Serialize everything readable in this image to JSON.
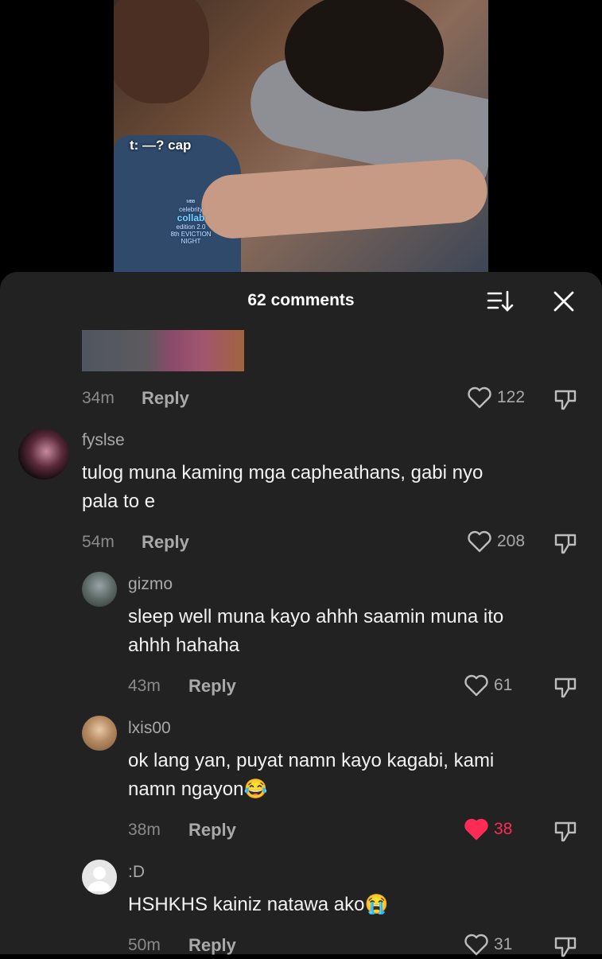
{
  "video": {
    "caption": "t: —? cap",
    "logo_lines": [
      "ᴹᴮᴮ",
      "celebrity",
      "collab",
      "edition 2.0",
      "8th EVICTION NIGHT"
    ]
  },
  "sheet": {
    "title": "62 comments"
  },
  "comments": [
    {
      "time": "34m",
      "reply": "Reply",
      "likes": "122"
    },
    {
      "username": "fyslse",
      "text_line1": "tulog muna kaming mga capheathans, gabi nyo",
      "text_line2": "pala to e",
      "time": "54m",
      "reply": "Reply",
      "likes": "208"
    },
    {
      "username": "gizmo",
      "text_line1": "sleep well muna kayo ahhh saamin muna ito",
      "text_line2": "ahhh hahaha",
      "time": "43m",
      "reply": "Reply",
      "likes": "61"
    },
    {
      "username": "lxis00",
      "text_line1": "ok lang yan, puyat namn kayo kagabi, kami",
      "text_line2": "namn ngayon😂",
      "time": "38m",
      "reply": "Reply",
      "likes": "38",
      "liked": true
    },
    {
      "username": ":D",
      "text_line1": "HSHKHS kainiz natawa ako😭",
      "time": "50m",
      "reply": "Reply",
      "likes": "31"
    }
  ],
  "colors": {
    "liked": "#fe2c55",
    "sheet_bg": "#222222"
  }
}
